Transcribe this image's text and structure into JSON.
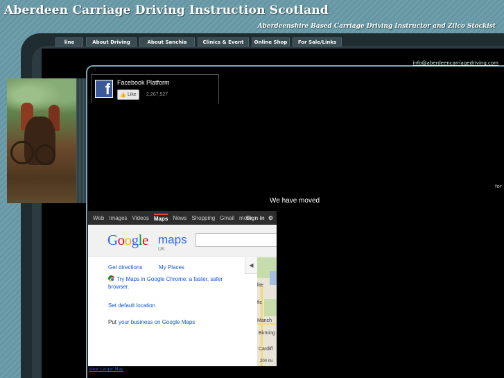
{
  "site": {
    "title": "Aberdeen Carriage Driving Instruction Scotland",
    "tagline": "Aberdeenshire Based Carriage Driving Instructor and Zilco Stockist",
    "email": "info@aberdeencarriagedriving.com"
  },
  "nav": {
    "items": [
      {
        "label": "line"
      },
      {
        "label": "About Driving"
      },
      {
        "label": "About Sanchia"
      },
      {
        "label": "Clinics & Event"
      },
      {
        "label": "Online Shop"
      },
      {
        "label": "For Sale/Links"
      }
    ]
  },
  "facebook": {
    "title": "Facebook Platform",
    "like_label": "Like",
    "count": "2,267,527",
    "logo_letter": "f"
  },
  "main": {
    "for_text": "for",
    "moved_text": "We have moved"
  },
  "gmap": {
    "bar": {
      "items": [
        "Web",
        "Images",
        "Videos",
        "Maps",
        "News",
        "Shopping",
        "Gmail"
      ],
      "more": "more",
      "signin": "Sign in"
    },
    "logo": "Google",
    "product": "maps",
    "region": "UK",
    "links": {
      "directions": "Get directions",
      "places": "My Places",
      "chrome": "Try Maps in Google Chrome: a faster, safer",
      "chrome_line2": "browser.",
      "default_location": "Set default location",
      "put": "Put",
      "business": "your business on Google Maps"
    },
    "map_labels": [
      "lite",
      "fic",
      "Manch",
      "Birming",
      "Cardiff",
      "200 mi"
    ]
  },
  "footer": {
    "view_larger": "View Larger Map"
  },
  "colors": {
    "background": "#6a99a6",
    "frame": "#1f2d31",
    "nav_item": "#3a4c51"
  }
}
